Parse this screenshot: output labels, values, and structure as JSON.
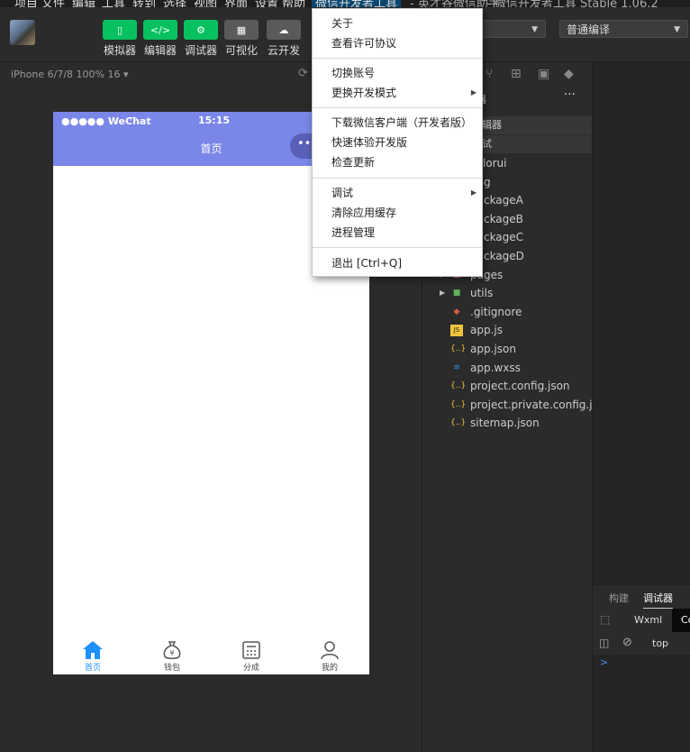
{
  "menubar": {
    "items": [
      "项目",
      "文件",
      "编辑",
      "工具",
      "转到",
      "选择",
      "视图",
      "界面",
      "设置",
      "帮助",
      "微信开发者工具",
      "- 英才谷微信助手",
      "- 微信开发者工具 Stable 1.06.2"
    ]
  },
  "toolbar": {
    "buttons": [
      {
        "label": "模拟器",
        "glyph": "▯"
      },
      {
        "label": "编辑器",
        "glyph": "</>"
      },
      {
        "label": "调试器",
        "glyph": "⚙"
      },
      {
        "label": "可视化",
        "glyph": "▦"
      },
      {
        "label": "云开发",
        "glyph": "☁"
      }
    ],
    "mode_select": "",
    "compile_select": "普通编译"
  },
  "simulator": {
    "device": "iPhone 6/7/8 100% 16 ▾",
    "status_left": "●●●●● WeChat",
    "time": "15:15",
    "page_title": "首页",
    "tabs": [
      {
        "label": "首页",
        "icon": "home-icon",
        "active": true
      },
      {
        "label": "钱包",
        "icon": "money-bag-icon",
        "active": false
      },
      {
        "label": "分成",
        "icon": "calculator-icon",
        "active": false
      },
      {
        "label": "我的",
        "icon": "user-icon",
        "active": false
      }
    ]
  },
  "explorer": {
    "title": "器",
    "more": "···",
    "sections": [
      "编辑器",
      "调试"
    ],
    "files": [
      {
        "name": "colorui",
        "icon": "folder-icon",
        "color": "#e8a33d"
      },
      {
        "name": "img",
        "icon": "folder-icon",
        "color": "#e8a33d"
      },
      {
        "name": "packageA",
        "icon": "folder-icon",
        "color": "#e8a33d"
      },
      {
        "name": "packageB",
        "icon": "folder-icon",
        "color": "#e8a33d"
      },
      {
        "name": "packageC",
        "icon": "folder-icon",
        "color": "#e8a33d"
      },
      {
        "name": "packageD",
        "icon": "folder-icon",
        "color": "#e8a33d"
      },
      {
        "name": "pages",
        "icon": "folder-icon",
        "color": "#e06c5b"
      },
      {
        "name": "utils",
        "icon": "folder-icon",
        "color": "#5fb35a"
      },
      {
        "name": ".gitignore",
        "icon": "git-icon",
        "color": "#e05a3a"
      },
      {
        "name": "app.js",
        "icon": "js-icon",
        "color": "#f0c43a"
      },
      {
        "name": "app.json",
        "icon": "json-icon",
        "color": "#e8c23a"
      },
      {
        "name": "app.wxss",
        "icon": "css-icon",
        "color": "#3c8cdf"
      },
      {
        "name": "project.config.json",
        "icon": "json-icon",
        "color": "#e8c23a"
      },
      {
        "name": "project.private.config.js...",
        "icon": "json-icon",
        "color": "#e8c23a"
      },
      {
        "name": "sitemap.json",
        "icon": "json-icon",
        "color": "#e8c23a"
      }
    ]
  },
  "devtools": {
    "tabs": [
      "构建",
      "调试器"
    ],
    "subtabs": [
      "Wxml",
      "Co"
    ],
    "filter": "top",
    "prompt": ">"
  },
  "menu": {
    "items": [
      {
        "label": "关于"
      },
      {
        "label": "查看许可协议"
      },
      {
        "label": "切换账号"
      },
      {
        "label": "更换开发模式",
        "submenu": true
      },
      {
        "label": "下载微信客户端（开发者版）"
      },
      {
        "label": "快速体验开发版"
      },
      {
        "label": "检查更新"
      },
      {
        "label": "调试",
        "submenu": true
      },
      {
        "label": "清除应用缓存"
      },
      {
        "label": "进程管理"
      },
      {
        "label": "退出  [Ctrl+Q]"
      }
    ]
  },
  "colors": {
    "accent_green": "#07c160",
    "nav_purple": "#7a86e8",
    "tab_active": "#1e90ff"
  }
}
